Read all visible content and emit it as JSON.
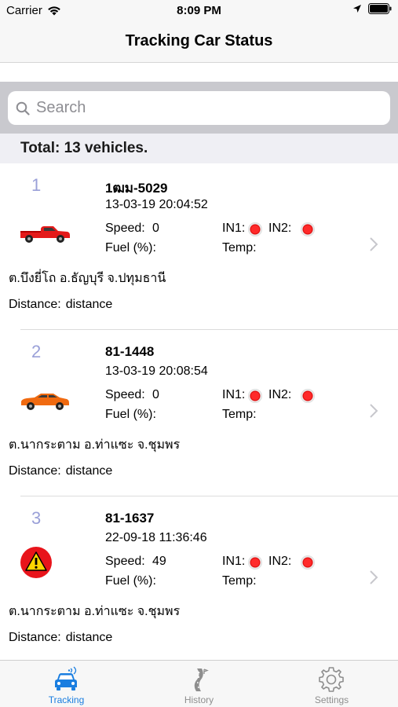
{
  "status_bar": {
    "carrier": "Carrier",
    "time": "8:09 PM"
  },
  "nav": {
    "title": "Tracking Car Status"
  },
  "search": {
    "placeholder": "Search"
  },
  "total": {
    "text": "Total: 13 vehicles."
  },
  "labels": {
    "speed": "Speed:",
    "fuel": "Fuel (%):",
    "in1": "IN1:",
    "in2": "IN2:",
    "temp": "Temp:",
    "distance": "Distance:"
  },
  "vehicles": [
    {
      "index": "1",
      "plate": "1ฒม-5029",
      "datetime": "13-03-19 20:04:52",
      "speed": "0",
      "address": "ต.บึงยี่โถ อ.ธัญบุรี จ.ปทุมธานี",
      "distance": "distance",
      "icon": "red-pickup-truck-icon"
    },
    {
      "index": "2",
      "plate": "81-1448",
      "datetime": "13-03-19 20:08:54",
      "speed": "0",
      "address": "ต.นากระตาม อ.ท่าแซะ จ.ชุมพร",
      "distance": "distance",
      "icon": "orange-sedan-icon"
    },
    {
      "index": "3",
      "plate": "81-1637",
      "datetime": "22-09-18 11:36:46",
      "speed": "49",
      "address": "ต.นากระตาม อ.ท่าแซะ จ.ชุมพร",
      "distance": "distance",
      "icon": "warning-icon"
    }
  ],
  "tabs": [
    {
      "label": "Tracking",
      "icon": "car-signal-icon",
      "active": true
    },
    {
      "label": "History",
      "icon": "road-history-icon",
      "active": false
    },
    {
      "label": "Settings",
      "icon": "gear-icon",
      "active": false
    }
  ],
  "colors": {
    "accent": "#1a7ee0",
    "index": "#9aa0d8",
    "indicator": "#e00000"
  }
}
